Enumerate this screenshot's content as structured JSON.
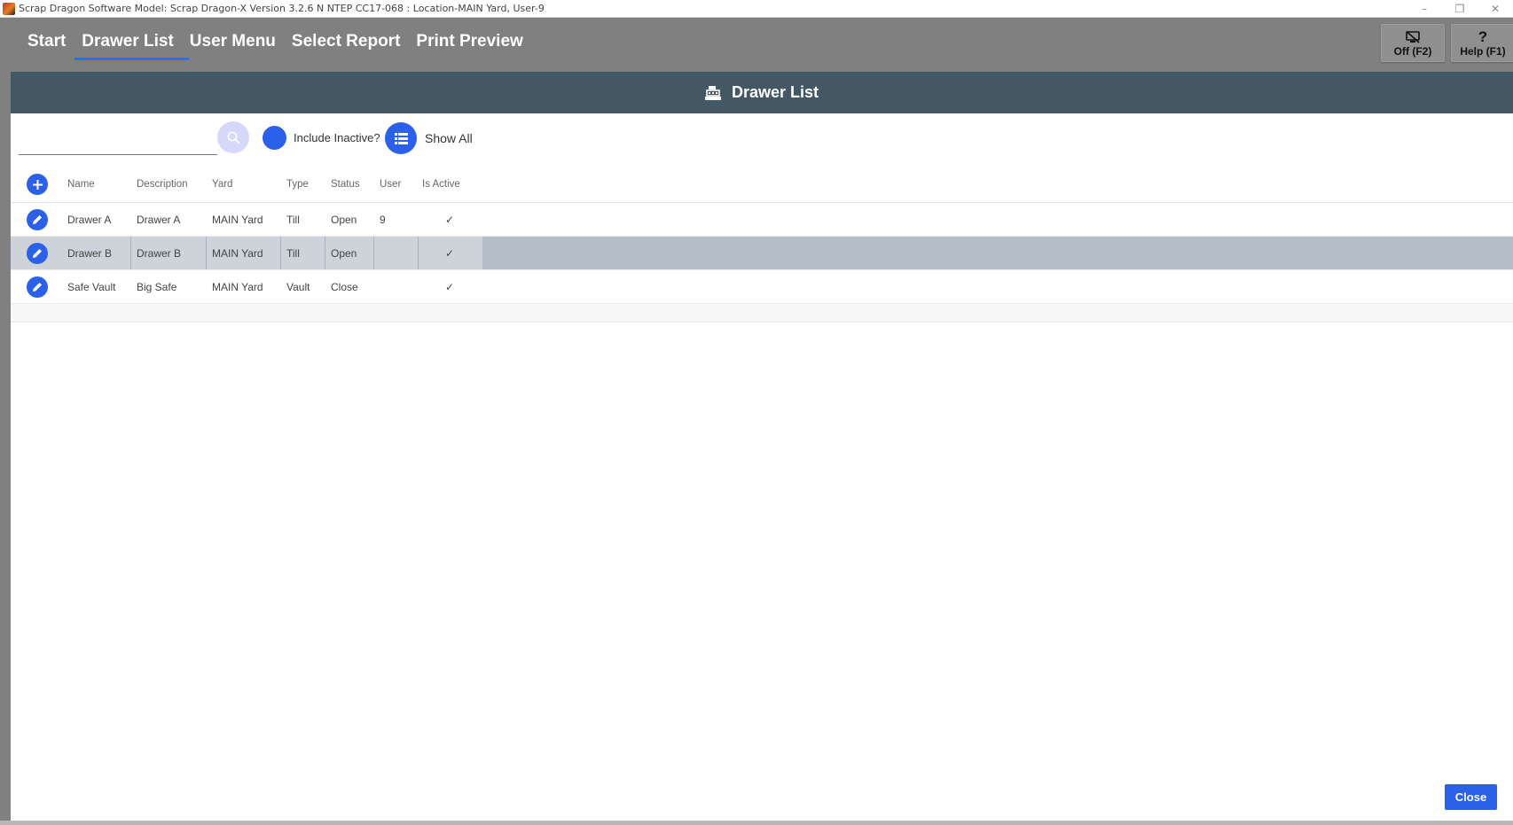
{
  "window": {
    "title": "Scrap Dragon Software Model: Scrap Dragon-X Version 3.2.6 N NTEP CC17-068 : Location-MAIN Yard, User-9",
    "controls": {
      "minimize": "–",
      "restore": "❐",
      "close": "✕"
    }
  },
  "nav": {
    "tabs": [
      {
        "label": "Start"
      },
      {
        "label": "Drawer List",
        "active": true
      },
      {
        "label": "User Menu"
      },
      {
        "label": "Select Report"
      },
      {
        "label": "Print Preview"
      }
    ],
    "off_button": {
      "label": "Off (F2)",
      "icon": "display-off-icon"
    },
    "help_button": {
      "label": "Help (F1)",
      "icon": "question-icon"
    }
  },
  "panel": {
    "title": "Drawer List",
    "icon": "cash-register-icon"
  },
  "toolbar": {
    "search_value": "",
    "search_placeholder": "",
    "include_inactive_label": "Include Inactive?",
    "show_all_label": "Show All"
  },
  "grid": {
    "columns": [
      "Name",
      "Description",
      "Yard",
      "Type",
      "Status",
      "User",
      "Is Active"
    ],
    "rows": [
      {
        "name": "Drawer A",
        "description": "Drawer A",
        "yard": "MAIN Yard",
        "type": "Till",
        "status": "Open",
        "user": "9",
        "is_active": "✓"
      },
      {
        "name": "Drawer B",
        "description": "Drawer B",
        "yard": "MAIN Yard",
        "type": "Till",
        "status": "Open",
        "user": "",
        "is_active": "✓",
        "selected": true
      },
      {
        "name": "Safe Vault",
        "description": "Big Safe",
        "yard": "MAIN Yard",
        "type": "Vault",
        "status": "Close",
        "user": "",
        "is_active": "✓"
      }
    ]
  },
  "footer": {
    "close_label": "Close"
  },
  "colors": {
    "accent": "#2a61e8",
    "header_bg": "#445863",
    "nav_bg": "#808080",
    "selected_row": "#b3bec8"
  }
}
